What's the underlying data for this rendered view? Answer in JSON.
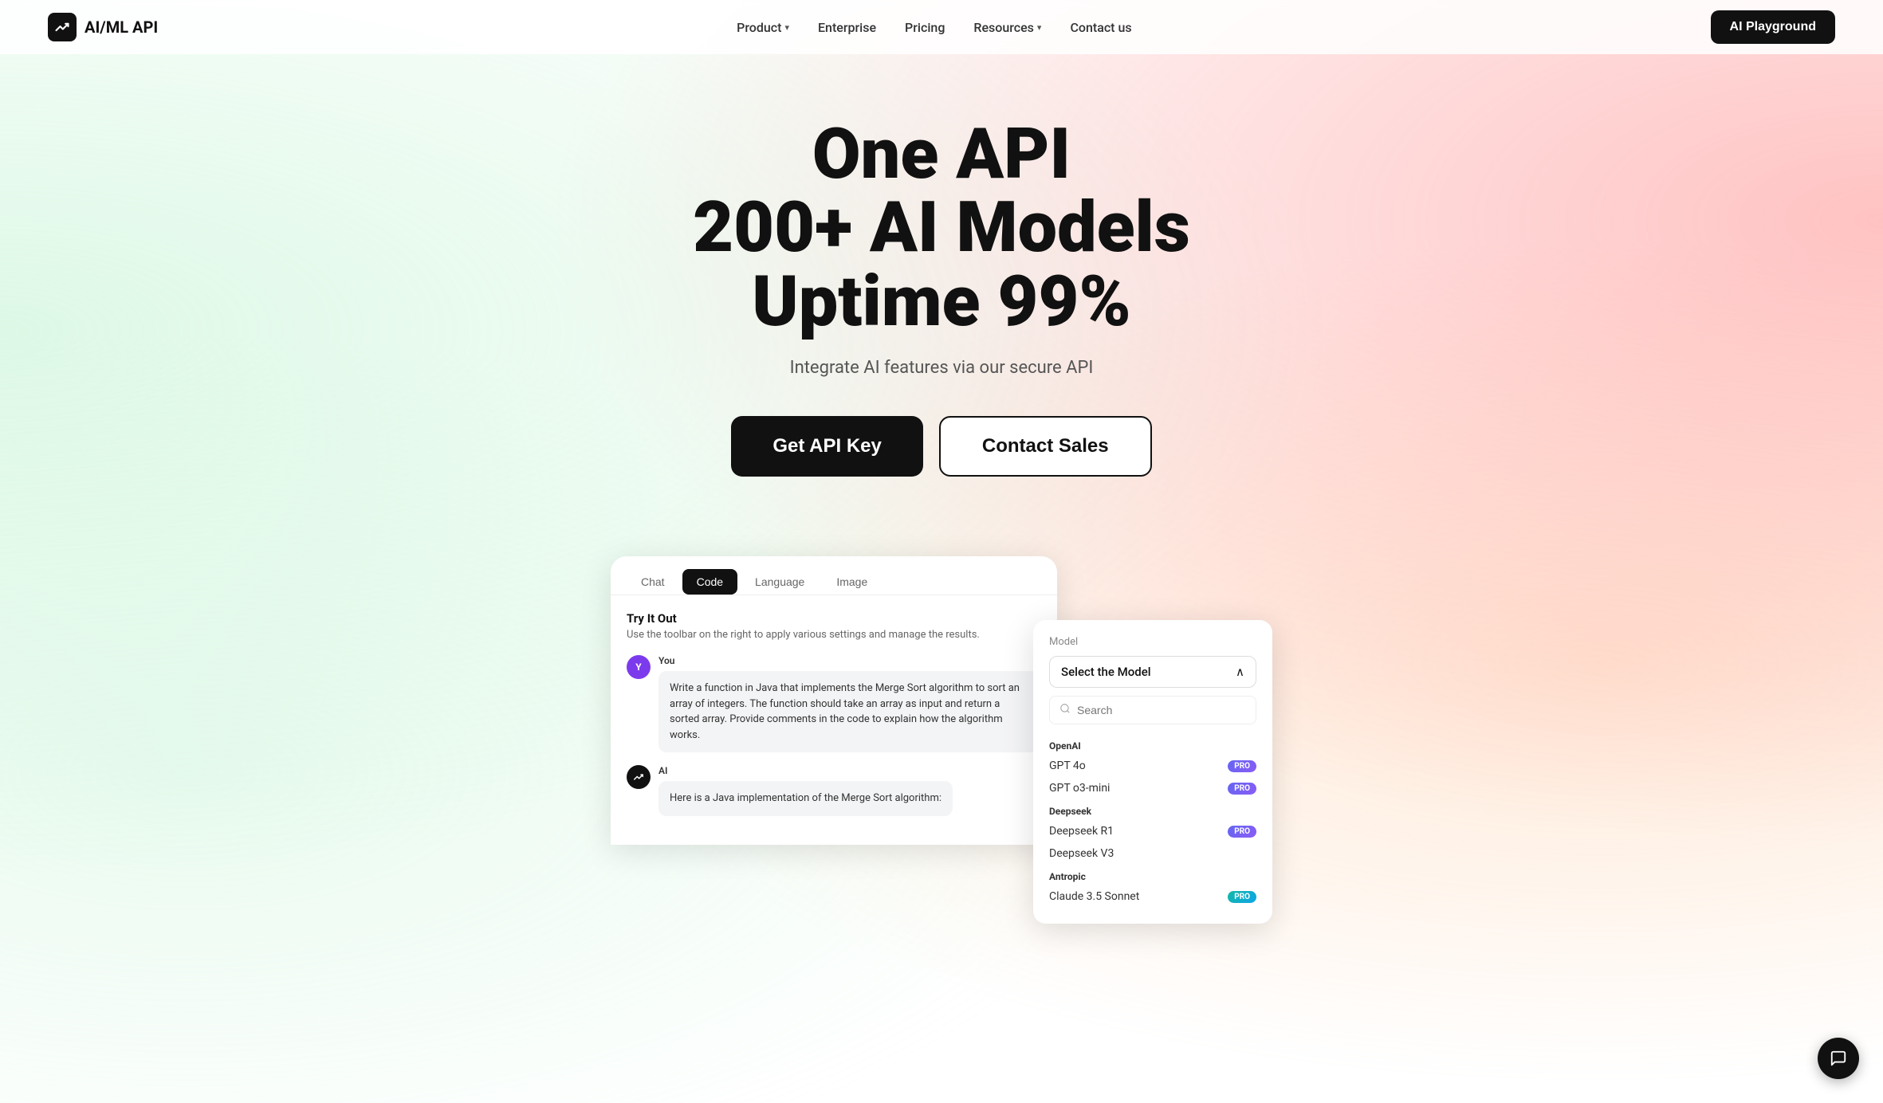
{
  "nav": {
    "logo_icon": "⚡",
    "logo_text": "AI/ML API",
    "links": [
      {
        "label": "Product",
        "has_dropdown": true
      },
      {
        "label": "Enterprise",
        "has_dropdown": false
      },
      {
        "label": "Pricing",
        "has_dropdown": false
      },
      {
        "label": "Resources",
        "has_dropdown": true
      },
      {
        "label": "Contact us",
        "has_dropdown": false
      }
    ],
    "cta_label": "AI Playground"
  },
  "hero": {
    "line1": "One API",
    "line2": "200+ AI Models",
    "line3": "Uptime 99%",
    "subtitle": "Integrate AI features via our secure API",
    "btn_primary": "Get API Key",
    "btn_secondary": "Contact Sales"
  },
  "demo": {
    "tabs": [
      {
        "label": "Chat",
        "active": false
      },
      {
        "label": "Code",
        "active": true
      },
      {
        "label": "Language",
        "active": false
      },
      {
        "label": "Image",
        "active": false
      }
    ],
    "try_it_out_title": "Try It Out",
    "try_it_out_desc": "Use the toolbar on the right to apply various settings and manage the results.",
    "messages": [
      {
        "role": "You",
        "avatar_letter": "Y",
        "avatar_type": "you",
        "text": "Write a function in Java that implements the Merge Sort algorithm to sort an array of integers. The function should take an array as input and return a sorted array. Provide comments in the code to explain how the algorithm works."
      },
      {
        "role": "AI",
        "avatar_letter": "~",
        "avatar_type": "ai",
        "text": "Here is a Java implementation of the Merge Sort algorithm:"
      }
    ]
  },
  "model_selector": {
    "panel_label": "Model",
    "select_placeholder": "Select the Model",
    "search_placeholder": "Search",
    "chevron": "∧",
    "providers": [
      {
        "name": "OpenAI",
        "models": [
          {
            "label": "GPT 4o",
            "badge": "PRO",
            "badge_type": "purple"
          },
          {
            "label": "GPT o3-mini",
            "badge": "PRO",
            "badge_type": "purple"
          }
        ]
      },
      {
        "name": "Deepseek",
        "models": [
          {
            "label": "Deepseek R1",
            "badge": "PRO",
            "badge_type": "purple"
          },
          {
            "label": "Deepseek V3",
            "badge": "",
            "badge_type": ""
          }
        ]
      },
      {
        "name": "Antropic",
        "models": [
          {
            "label": "Claude 3.5 Sonnet",
            "badge": "PRO",
            "badge_type": "teal"
          }
        ]
      }
    ]
  },
  "chat_bubble": {
    "icon": "💬"
  }
}
